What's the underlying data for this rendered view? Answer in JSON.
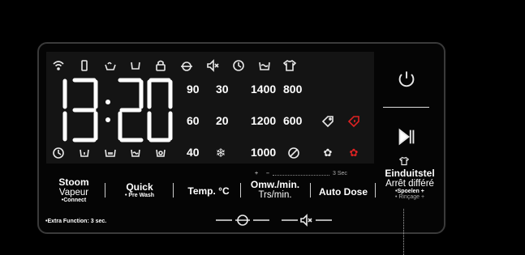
{
  "display": {
    "time_left": "13",
    "time_right": "20",
    "temps": [
      "90",
      "60",
      "40"
    ],
    "temps2": [
      "30",
      "20"
    ],
    "spins_a": [
      "1400",
      "1200",
      "1000"
    ],
    "spins_b": [
      "800",
      "600"
    ]
  },
  "buttons": {
    "stoom_title": "Stoom",
    "stoom_sub": "Vapeur",
    "stoom_note": "•Connect",
    "quick_title": "Quick",
    "quick_note": "• Pre Wash",
    "temp_label": "Temp. °C",
    "spin_title": "Omw./min.",
    "spin_sub": "Trs/min.",
    "spin_note_plus": "+",
    "spin_note_minus": "–",
    "spin_note_time": "3 Sec",
    "auto_label": "Auto Dose",
    "end_title": "Einduitstel",
    "end_sub": "Arrêt différé",
    "end_note1": "•Spoelen +",
    "end_note2": "• Rinçage +"
  },
  "extra_function": "•Extra Function: 3 sec.",
  "colors": {
    "accent_red": "#d22222",
    "text": "#ffffff",
    "panel": "#050505"
  }
}
